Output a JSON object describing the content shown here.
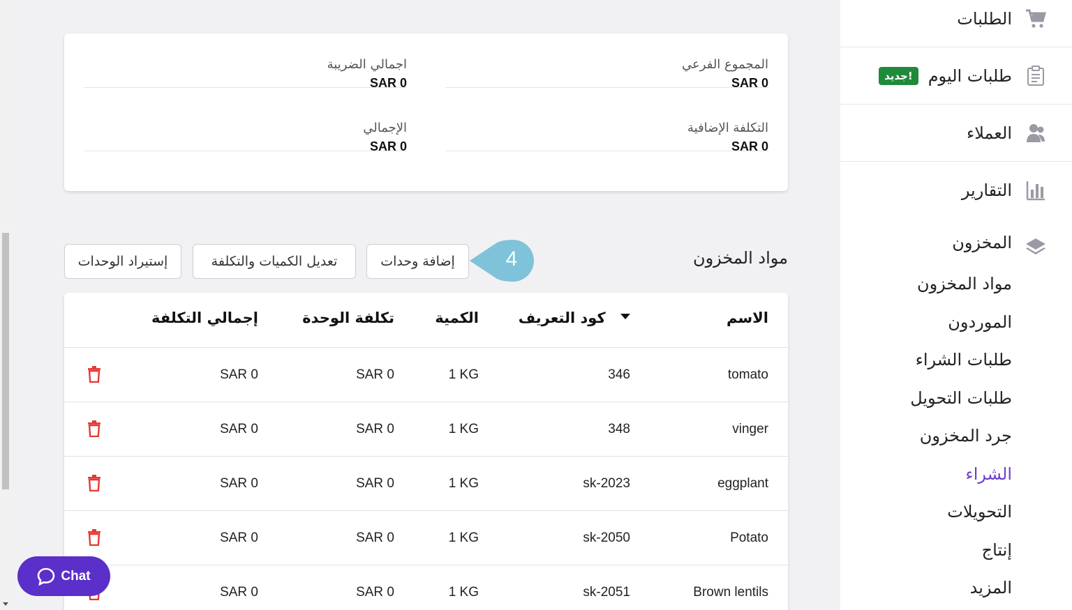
{
  "sidebar": {
    "items": [
      {
        "label": "الطلبات",
        "icon": "cart-icon"
      },
      {
        "label": "طلبات اليوم",
        "badge": "جديد!",
        "icon": "clipboard-icon"
      },
      {
        "label": "العملاء",
        "icon": "customers-icon"
      },
      {
        "label": "التقارير",
        "icon": "bar-chart-icon"
      }
    ],
    "inventory": {
      "label": "المخزون",
      "icon": "layers-icon",
      "sub_items": [
        "مواد المخزون",
        "الموردون",
        "طلبات الشراء",
        "طلبات التحويل",
        "جرد المخزون",
        "الشراء",
        "التحويلات",
        "إنتاج",
        "المزيد"
      ],
      "active": "الشراء"
    }
  },
  "summary": {
    "subtotal_label": "المجموع الفرعي",
    "subtotal_value": "SAR 0",
    "tax_label": "اجمالي الضريبة",
    "tax_value": "SAR 0",
    "extra_label": "التكلفة الإضافية",
    "extra_value": "SAR 0",
    "total_label": "الإجمالي",
    "total_value": "SAR 0"
  },
  "section": {
    "title": "مواد المخزون",
    "add_units": "إضافة وحدات",
    "edit_qty_cost": "تعديل الكميات والتكلفة",
    "import_units": "إستيراد الوحدات",
    "step_number": "4"
  },
  "table": {
    "headers": {
      "name": "الاسم",
      "sku": "كود التعريف",
      "qty": "الكمية",
      "unit_cost": "تكلفة الوحدة",
      "total_cost": "إجمالي التكلفة"
    },
    "rows": [
      {
        "name": "tomato",
        "sku": "346",
        "qty": "1 KG",
        "unit_cost": "SAR 0",
        "total_cost": "SAR 0"
      },
      {
        "name": "vinger",
        "sku": "348",
        "qty": "1 KG",
        "unit_cost": "SAR 0",
        "total_cost": "SAR 0"
      },
      {
        "name": "eggplant",
        "sku": "sk-2023",
        "qty": "1 KG",
        "unit_cost": "SAR 0",
        "total_cost": "SAR 0"
      },
      {
        "name": "Potato",
        "sku": "sk-2050",
        "qty": "1 KG",
        "unit_cost": "SAR 0",
        "total_cost": "SAR 0"
      },
      {
        "name": "Brown lentils",
        "sku": "sk-2051",
        "qty": "1 KG",
        "unit_cost": "SAR 0",
        "total_cost": "SAR 0"
      }
    ]
  },
  "chat": {
    "label": "Chat"
  },
  "colors": {
    "accent": "#6e3fd0",
    "badge": "#1e8a3a",
    "callout": "#7ec3d9",
    "trash": "#e53935",
    "chat": "#5b2fc9"
  }
}
